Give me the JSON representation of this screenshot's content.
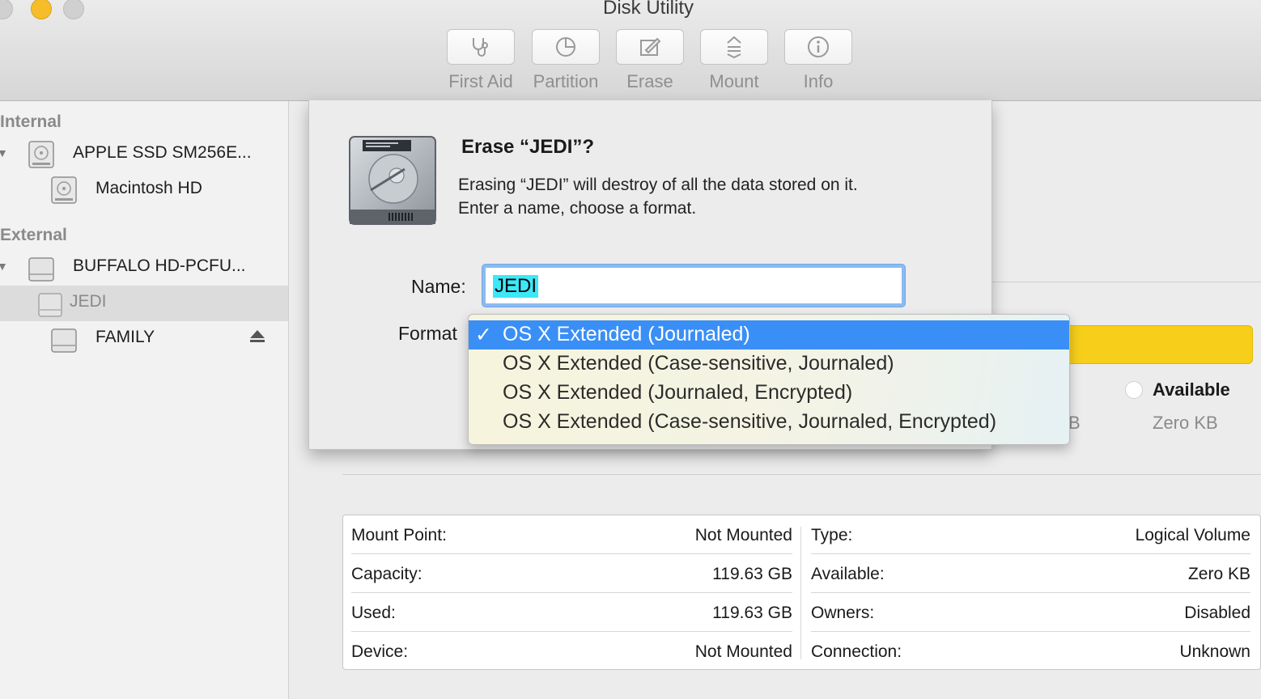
{
  "window": {
    "title": "Disk Utility"
  },
  "toolbar": {
    "items": [
      {
        "label": "First Aid",
        "icon": "stethoscope-icon"
      },
      {
        "label": "Partition",
        "icon": "pie-icon"
      },
      {
        "label": "Erase",
        "icon": "erase-pencil-icon"
      },
      {
        "label": "Mount",
        "icon": "mount-arrows-icon"
      },
      {
        "label": "Info",
        "icon": "info-icon"
      }
    ]
  },
  "sidebar": {
    "internal_header": "Internal",
    "external_header": "External",
    "items": [
      {
        "label": "APPLE SSD SM256E..."
      },
      {
        "label": "Macintosh HD"
      },
      {
        "label": "BUFFALO HD-PCFU..."
      },
      {
        "label": "JEDI",
        "selected": true
      },
      {
        "label": "FAMILY"
      }
    ]
  },
  "usage": {
    "available_label": "Available",
    "available_value": "Zero KB",
    "partial_text": "B",
    "used_color": "#f7cf1a"
  },
  "info": {
    "left": [
      {
        "key": "Mount Point:",
        "value": "Not Mounted"
      },
      {
        "key": "Capacity:",
        "value": "119.63 GB"
      },
      {
        "key": "Used:",
        "value": "119.63 GB"
      },
      {
        "key": "Device:",
        "value": "Not Mounted"
      }
    ],
    "right": [
      {
        "key": "Type:",
        "value": "Logical Volume"
      },
      {
        "key": "Available:",
        "value": "Zero KB"
      },
      {
        "key": "Owners:",
        "value": "Disabled"
      },
      {
        "key": "Connection:",
        "value": "Unknown"
      }
    ]
  },
  "erase_sheet": {
    "title": "Erase “JEDI”?",
    "message_line1": "Erasing “JEDI” will destroy of all the data stored on it.",
    "message_line2": "Enter a name, choose a format.",
    "name_label": "Name:",
    "name_value": "JEDI",
    "format_label": "Format",
    "format_options": [
      {
        "label": "OS X Extended (Journaled)",
        "check": "✓",
        "selected": true
      },
      {
        "label": "OS X Extended (Case-sensitive, Journaled)",
        "check": "",
        "selected": false
      },
      {
        "label": "OS X Extended (Journaled, Encrypted)",
        "check": "",
        "selected": false
      },
      {
        "label": "OS X Extended (Case-sensitive, Journaled, Encrypted)",
        "check": "",
        "selected": false
      }
    ],
    "highlight_color": "#3a8ff6"
  }
}
